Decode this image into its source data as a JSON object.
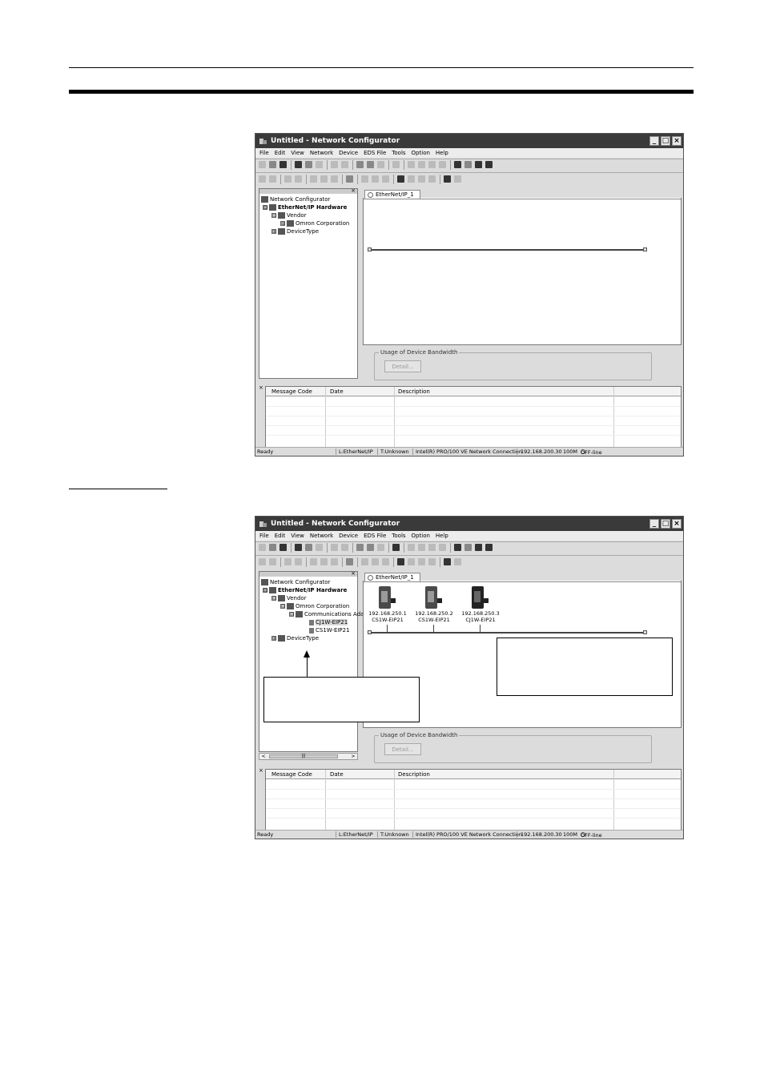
{
  "window": {
    "title": "Untitled - Network Configurator",
    "menus": [
      "File",
      "Edit",
      "View",
      "Network",
      "Device",
      "EDS File",
      "Tools",
      "Option",
      "Help"
    ],
    "min_glyph": "_",
    "max_glyph": "□",
    "close_glyph": "×"
  },
  "tree": {
    "close_glyph": "×",
    "root": "Network Configurator",
    "hardware": "EtherNet/IP Hardware",
    "vendor": "Vendor",
    "omron": "Omron Corporation",
    "device_type": "DeviceType",
    "comm_adapter": "Communications Ada",
    "device_cj": "CJ1W-EIP21",
    "device_cs": "CS1W-EIP21",
    "collapse_glyph": "⊟",
    "expand_glyph": "⊞"
  },
  "network_tab": "EtherNet/IP_1",
  "bandwidth": {
    "label": "Usage of Device Bandwidth",
    "detail_button": "Detail..."
  },
  "message_table": {
    "close_glyph": "×",
    "headers": [
      "Message Code",
      "Date",
      "Description",
      ""
    ]
  },
  "status": {
    "ready": "Ready",
    "network": "L:EtherNet/IP",
    "target": "T:Unknown",
    "adapter": "Intel(R) PRO/100 VE Network Connection",
    "ip": "192.168.200.30",
    "speed": "100M",
    "mode": "OFF-line"
  },
  "devices": [
    {
      "ip": "192.168.250.1",
      "model": "CS1W-EIP21"
    },
    {
      "ip": "192.168.250.2",
      "model": "CS1W-EIP21"
    },
    {
      "ip": "192.168.250.3",
      "model": "CJ1W-EIP21"
    }
  ],
  "scroll": {
    "left": "<",
    "right": ">",
    "grip": "|||"
  }
}
